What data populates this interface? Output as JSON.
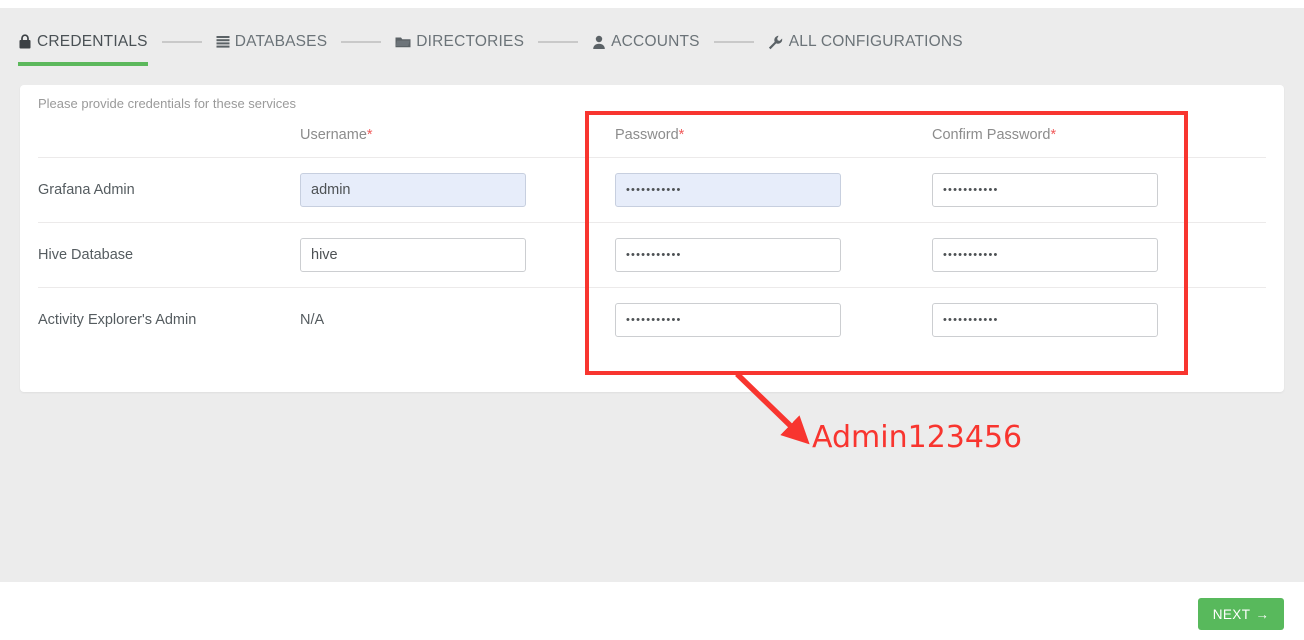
{
  "wizard": {
    "steps": [
      {
        "label": "CREDENTIALS",
        "icon": "lock-icon",
        "active": true
      },
      {
        "label": "DATABASES",
        "icon": "database-icon",
        "active": false
      },
      {
        "label": "DIRECTORIES",
        "icon": "folder-icon",
        "active": false
      },
      {
        "label": "ACCOUNTS",
        "icon": "user-icon",
        "active": false
      },
      {
        "label": "ALL CONFIGURATIONS",
        "icon": "wrench-icon",
        "active": false
      }
    ],
    "active_underline_color": "#5cb85c"
  },
  "card": {
    "subtitle": "Please provide credentials for these services",
    "columns": {
      "service": "",
      "username": "Username",
      "password": "Password",
      "confirm_password": "Confirm Password",
      "required_marker": "*"
    },
    "rows": [
      {
        "service": "Grafana Admin",
        "username_value": "admin",
        "username_is_input": true,
        "username_highlighted": true,
        "password_value": "•••••••••••",
        "password_highlighted": true,
        "confirm_value": "•••••••••••",
        "confirm_highlighted": false
      },
      {
        "service": "Hive Database",
        "username_value": "hive",
        "username_is_input": true,
        "username_highlighted": false,
        "password_value": "•••••••••••",
        "password_highlighted": false,
        "confirm_value": "•••••••••••",
        "confirm_highlighted": false
      },
      {
        "service": "Activity Explorer's Admin",
        "username_value": "N/A",
        "username_is_input": false,
        "username_highlighted": false,
        "password_value": "•••••••••••",
        "password_highlighted": false,
        "confirm_value": "•••••••••••",
        "confirm_highlighted": false
      }
    ]
  },
  "annotation": {
    "text": "Admin123456",
    "color": "#f8352f"
  },
  "footer": {
    "next_label": "NEXT",
    "next_arrow": "→",
    "next_color": "#58b95c"
  }
}
